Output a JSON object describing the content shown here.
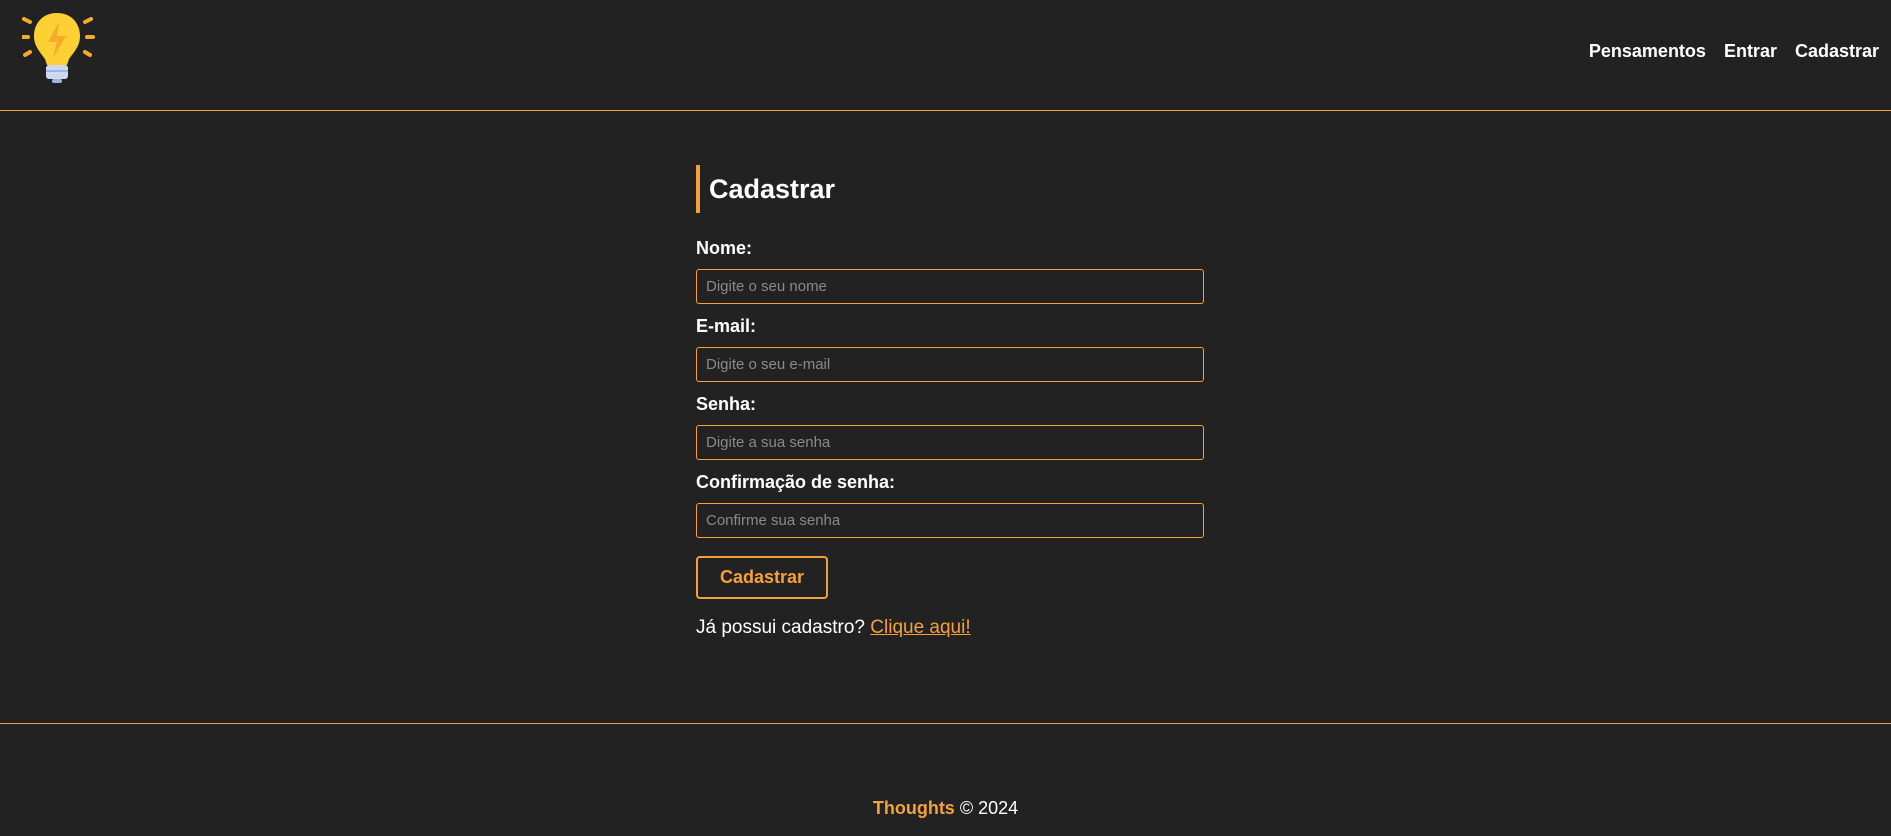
{
  "header": {
    "logo_icon": "lightbulb-bolt-icon",
    "nav": [
      {
        "label": "Pensamentos"
      },
      {
        "label": "Entrar"
      },
      {
        "label": "Cadastrar"
      }
    ]
  },
  "main": {
    "title": "Cadastrar",
    "fields": [
      {
        "label": "Nome:",
        "placeholder": "Digite o seu nome",
        "value": ""
      },
      {
        "label": "E-mail:",
        "placeholder": "Digite o seu e-mail",
        "value": ""
      },
      {
        "label": "Senha:",
        "placeholder": "Digite a sua senha",
        "value": ""
      },
      {
        "label": "Confirmação de senha:",
        "placeholder": "Confirme sua senha",
        "value": ""
      }
    ],
    "submit_label": "Cadastrar",
    "login_prompt": "Já possui cadastro?",
    "login_link": "Clique aqui!"
  },
  "footer": {
    "brand": "Thoughts",
    "copyright": "© 2024"
  },
  "colors": {
    "accent": "#f5a03a",
    "background": "#222222",
    "text": "#ffffff"
  }
}
